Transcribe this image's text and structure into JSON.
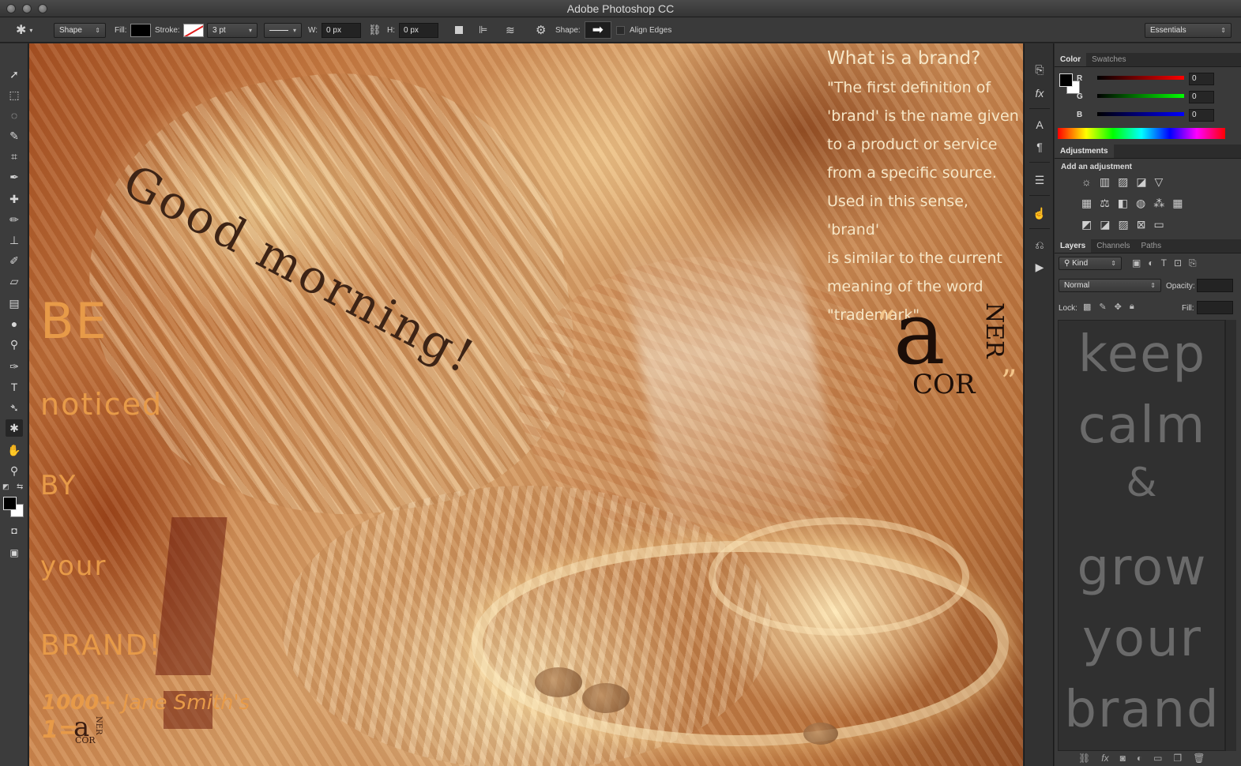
{
  "window": {
    "title": "Adobe Photoshop CC"
  },
  "options_bar": {
    "mode": "Shape",
    "fill_label": "Fill:",
    "stroke_label": "Stroke:",
    "stroke_width": "3 pt",
    "w_label": "W:",
    "w_value": "0 px",
    "h_label": "H:",
    "h_value": "0 px",
    "shape_label": "Shape:",
    "align_edges": "Align Edges",
    "workspace": "Essentials"
  },
  "canvas": {
    "good_morning": "Good morning!",
    "be_words": [
      "BE",
      "noticed",
      "BY",
      "your",
      "BRAND!"
    ],
    "count_line_bold": "1000+",
    "count_line_rest": " Jane Smith's",
    "one_eq": "1=",
    "quote_question": "What is a brand?",
    "quote_lines": [
      "\"The first definition of",
      "'brand' is the name given",
      "to a product or service",
      "from a specific source.",
      "Used in this sense, 'brand'",
      "is similar to the current",
      "meaning of the word",
      "\"trademark\"."
    ],
    "logo": {
      "a": "a",
      "cor": "COR",
      "ner": "NER",
      "quote_open": "“",
      "quote_close": "”"
    }
  },
  "color_panel": {
    "tabs": [
      "Color",
      "Swatches"
    ],
    "r_label": "R",
    "g_label": "G",
    "b_label": "B",
    "r": "0",
    "g": "0",
    "b": "0"
  },
  "adjustments_panel": {
    "tab": "Adjustments",
    "heading": "Add an adjustment"
  },
  "layers_panel": {
    "tabs": [
      "Layers",
      "Channels",
      "Paths"
    ],
    "kind": "Kind",
    "blend_mode": "Normal",
    "opacity_label": "Opacity:",
    "lock_label": "Lock:",
    "fill_label": "Fill:",
    "preview_text": [
      "keep",
      "calm",
      "&",
      "grow",
      "your",
      "brand"
    ]
  },
  "colors": {
    "accent_text": "#e79a48",
    "quote_text": "#f6e6c6",
    "ui_bg": "#3a3a3a"
  },
  "icons": {
    "tools": [
      "move-icon",
      "marquee-icon",
      "lasso-icon",
      "quick-select-icon",
      "crop-icon",
      "eyedropper-icon",
      "healing-icon",
      "brush-icon",
      "stamp-icon",
      "history-brush-icon",
      "eraser-icon",
      "gradient-icon",
      "blur-icon",
      "dodge-icon",
      "pen-icon",
      "type-icon",
      "path-select-icon",
      "custom-shape-icon",
      "hand-icon",
      "zoom-icon"
    ]
  }
}
